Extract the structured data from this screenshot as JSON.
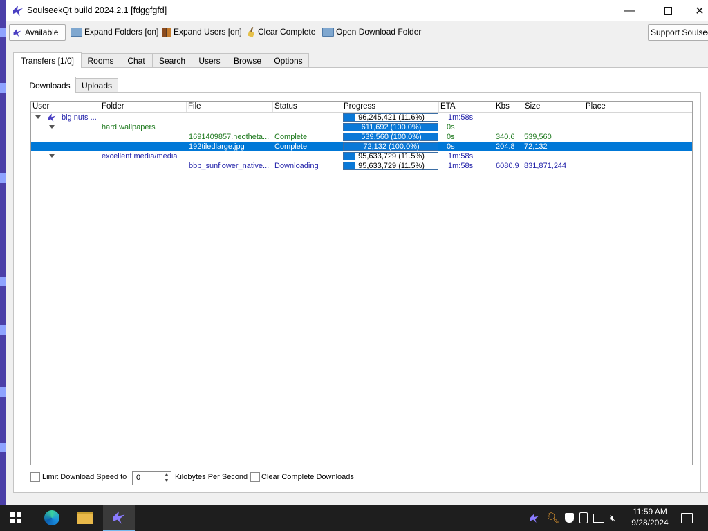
{
  "window": {
    "title": "SoulseekQt build 2024.2.1 [fdggfgfd]"
  },
  "toolbar": {
    "available": "Available",
    "expand_folders": "Expand Folders [on]",
    "expand_users": "Expand Users [on]",
    "clear_complete": "Clear Complete",
    "open_download_folder": "Open Download Folder",
    "support": "Support Soulseek"
  },
  "tabs": [
    "Transfers [1/0]",
    "Rooms",
    "Chat",
    "Search",
    "Users",
    "Browse",
    "Options"
  ],
  "subtabs": [
    "Downloads",
    "Uploads"
  ],
  "columns": [
    "User",
    "Folder",
    "File",
    "Status",
    "Progress",
    "ETA",
    "Kbs",
    "Size",
    "Place"
  ],
  "rows": [
    {
      "user": "big nuts ...",
      "folder": "",
      "file": "",
      "status": "",
      "progress": "96,245,421 (11.6%)",
      "progress_fraction": 0.116,
      "eta": "1m:58s",
      "kbs": "",
      "size": "",
      "place": ""
    },
    {
      "user": "",
      "folder": "hard wallpapers",
      "file": "",
      "status": "",
      "progress": "611,692 (100.0%)",
      "progress_fraction": 1.0,
      "eta": "0s",
      "kbs": "",
      "size": "",
      "place": ""
    },
    {
      "user": "",
      "folder": "",
      "file": "1691409857.neotheta...",
      "status": "Complete",
      "progress": "539,560 (100.0%)",
      "progress_fraction": 1.0,
      "eta": "0s",
      "kbs": "340.6",
      "size": "539,560",
      "place": ""
    },
    {
      "user": "",
      "folder": "",
      "file": "192tiledlarge.jpg",
      "status": "Complete",
      "progress": "72,132 (100.0%)",
      "progress_fraction": 1.0,
      "eta": "0s",
      "kbs": "204.8",
      "size": "72,132",
      "place": ""
    },
    {
      "user": "",
      "folder": "excellent media/media",
      "file": "",
      "status": "",
      "progress": "95,633,729 (11.5%)",
      "progress_fraction": 0.115,
      "eta": "1m:58s",
      "kbs": "",
      "size": "",
      "place": ""
    },
    {
      "user": "",
      "folder": "",
      "file": "bbb_sunflower_native...",
      "status": "Downloading",
      "progress": "95,633,729 (11.5%)",
      "progress_fraction": 0.115,
      "eta": "1m:58s",
      "kbs": "6080.9",
      "size": "831,871,244",
      "place": ""
    }
  ],
  "bottom": {
    "limit_label": "Limit Download Speed to",
    "limit_value": "0",
    "unit_label": "Kilobytes Per Second",
    "clear_label": "Clear Complete Downloads"
  },
  "taskbar": {
    "time": "11:59 AM",
    "date": "9/28/2024"
  },
  "colors": {
    "accent": "#0078d7",
    "user_text": "#1f1fa8",
    "folder_text": "#1f7a1f"
  }
}
